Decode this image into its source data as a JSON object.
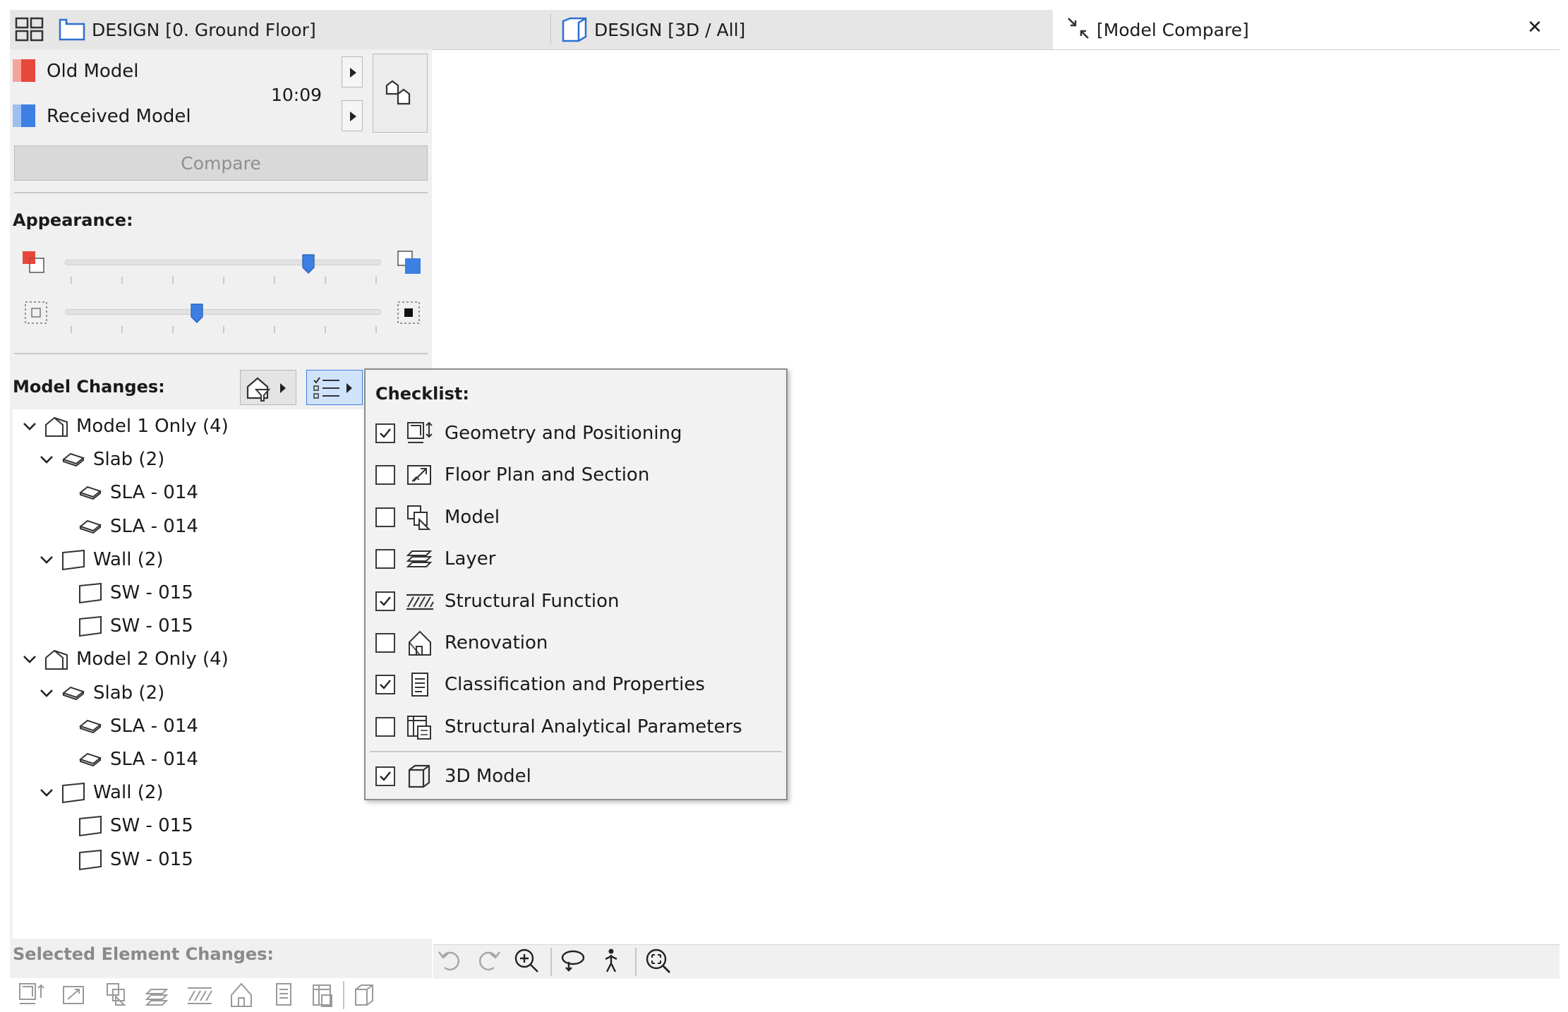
{
  "tabs": [
    {
      "label": "DESIGN [0. Ground Floor]",
      "icon": "floor-plan-icon"
    },
    {
      "label": "DESIGN [3D / All]",
      "icon": "3d-view-icon"
    },
    {
      "label": "[Model Compare]",
      "icon": "model-compare-icon",
      "active": true
    }
  ],
  "tab_bar": {
    "grid_icon": "tab-overview-icon",
    "close_glyph": "✕"
  },
  "models": {
    "old": {
      "label": "Old Model",
      "color": "#e8473b"
    },
    "received": {
      "label": "Received Model",
      "color": "#3d7fe3"
    },
    "time": "10:09"
  },
  "compare_button": "Compare",
  "appearance": {
    "title": "Appearance:",
    "slider1_value_fraction": 0.77,
    "slider2_value_fraction": 0.42,
    "accent_color": "#3d7fe3"
  },
  "model_changes": {
    "title": "Model Changes:",
    "tree": [
      {
        "label": "Model 1 Only (4)",
        "level": 0,
        "icon": "model-house-icon",
        "expanded": true
      },
      {
        "label": "Slab (2)",
        "level": 1,
        "icon": "slab-icon",
        "expanded": true
      },
      {
        "label": "SLA - 014",
        "level": 2,
        "icon": "slab-icon"
      },
      {
        "label": "SLA - 014",
        "level": 2,
        "icon": "slab-icon"
      },
      {
        "label": "Wall (2)",
        "level": 1,
        "icon": "wall-icon",
        "expanded": true
      },
      {
        "label": "SW - 015",
        "level": 2,
        "icon": "wall-icon"
      },
      {
        "label": "SW - 015",
        "level": 2,
        "icon": "wall-icon"
      },
      {
        "label": "Model 2 Only (4)",
        "level": 0,
        "icon": "model-house-icon",
        "expanded": true
      },
      {
        "label": "Slab (2)",
        "level": 1,
        "icon": "slab-icon",
        "expanded": true
      },
      {
        "label": "SLA - 014",
        "level": 2,
        "icon": "slab-icon"
      },
      {
        "label": "SLA - 014",
        "level": 2,
        "icon": "slab-icon"
      },
      {
        "label": "Wall (2)",
        "level": 1,
        "icon": "wall-icon",
        "expanded": true
      },
      {
        "label": "SW - 015",
        "level": 2,
        "icon": "wall-icon"
      },
      {
        "label": "SW - 015",
        "level": 2,
        "icon": "wall-icon"
      }
    ]
  },
  "checklist": {
    "title": "Checklist:",
    "items": [
      {
        "label": "Geometry and Positioning",
        "checked": true,
        "icon": "geometry-icon"
      },
      {
        "label": "Floor Plan and Section",
        "checked": false,
        "icon": "floor-plan-section-icon"
      },
      {
        "label": "Model",
        "checked": false,
        "icon": "model-icon"
      },
      {
        "label": "Layer",
        "checked": false,
        "icon": "layer-icon"
      },
      {
        "label": "Structural Function",
        "checked": true,
        "icon": "structural-function-icon"
      },
      {
        "label": "Renovation",
        "checked": false,
        "icon": "renovation-icon"
      },
      {
        "label": "Classification and Properties",
        "checked": true,
        "icon": "classification-icon"
      },
      {
        "label": "Structural Analytical Parameters",
        "checked": false,
        "icon": "structural-analytical-icon"
      }
    ],
    "extra_item": {
      "label": "3D Model",
      "checked": true,
      "icon": "3d-model-icon"
    }
  },
  "selected_element_changes": {
    "title": "Selected Element Changes:"
  }
}
